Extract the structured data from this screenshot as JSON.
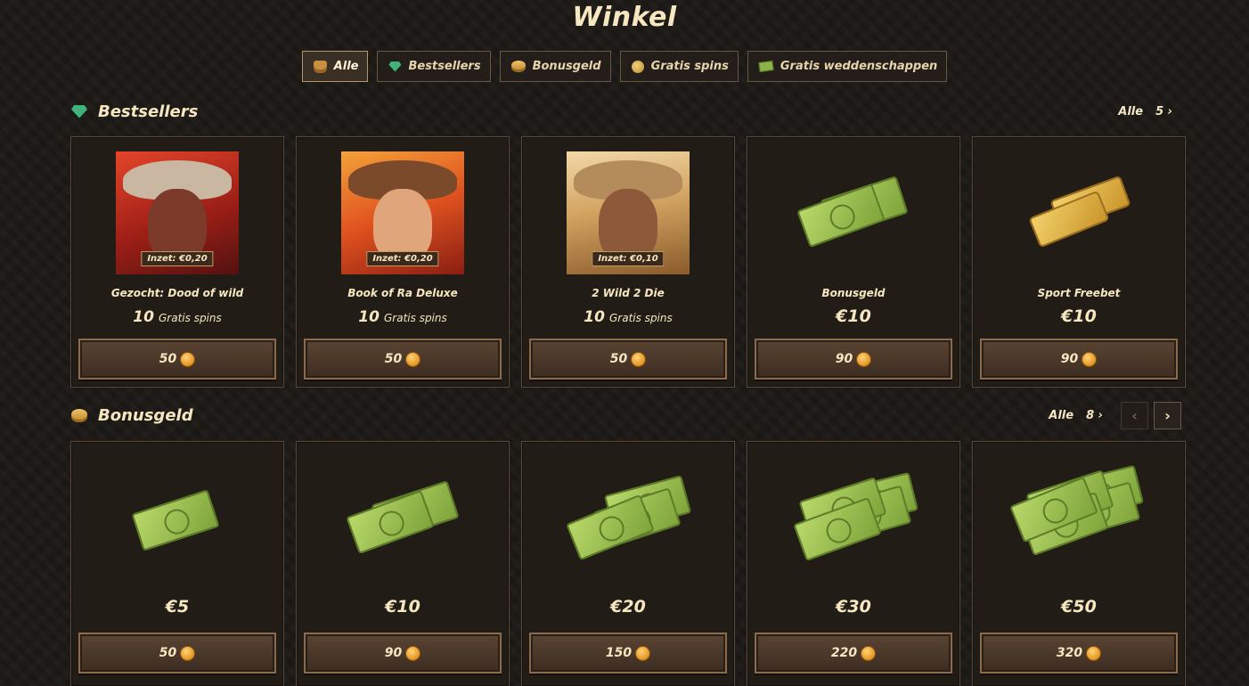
{
  "page": {
    "title": "Winkel"
  },
  "filters": [
    {
      "label": "Alle",
      "icon": "bag-icon",
      "active": true
    },
    {
      "label": "Bestsellers",
      "icon": "gem-icon"
    },
    {
      "label": "Bonusgeld",
      "icon": "coins-icon"
    },
    {
      "label": "Gratis spins",
      "icon": "coin-icon"
    },
    {
      "label": "Gratis weddenschappen",
      "icon": "cash-icon"
    }
  ],
  "bestsellers": {
    "title": "Bestsellers",
    "see_all_label": "Alle",
    "count": "5",
    "items": [
      {
        "stake": "Inzet: €0,20",
        "name": "Gezocht: Dood of wild",
        "spins": "10",
        "spins_label": "Gratis spins",
        "price": "50"
      },
      {
        "stake": "Inzet: €0,20",
        "name": "Book of Ra Deluxe",
        "spins": "10",
        "spins_label": "Gratis spins",
        "price": "50"
      },
      {
        "stake": "Inzet: €0,10",
        "name": "2 Wild 2 Die",
        "spins": "10",
        "spins_label": "Gratis spins",
        "price": "50"
      },
      {
        "name": "Bonusgeld",
        "amount": "€10",
        "price": "90"
      },
      {
        "name": "Sport Freebet",
        "amount": "€10",
        "price": "90"
      }
    ]
  },
  "bonusgeld": {
    "title": "Bonusgeld",
    "see_all_label": "Alle",
    "count": "8",
    "items": [
      {
        "amount": "€5",
        "price": "50"
      },
      {
        "amount": "€10",
        "price": "90"
      },
      {
        "amount": "€20",
        "price": "150"
      },
      {
        "amount": "€30",
        "price": "220"
      },
      {
        "amount": "€50",
        "price": "320"
      }
    ]
  }
}
